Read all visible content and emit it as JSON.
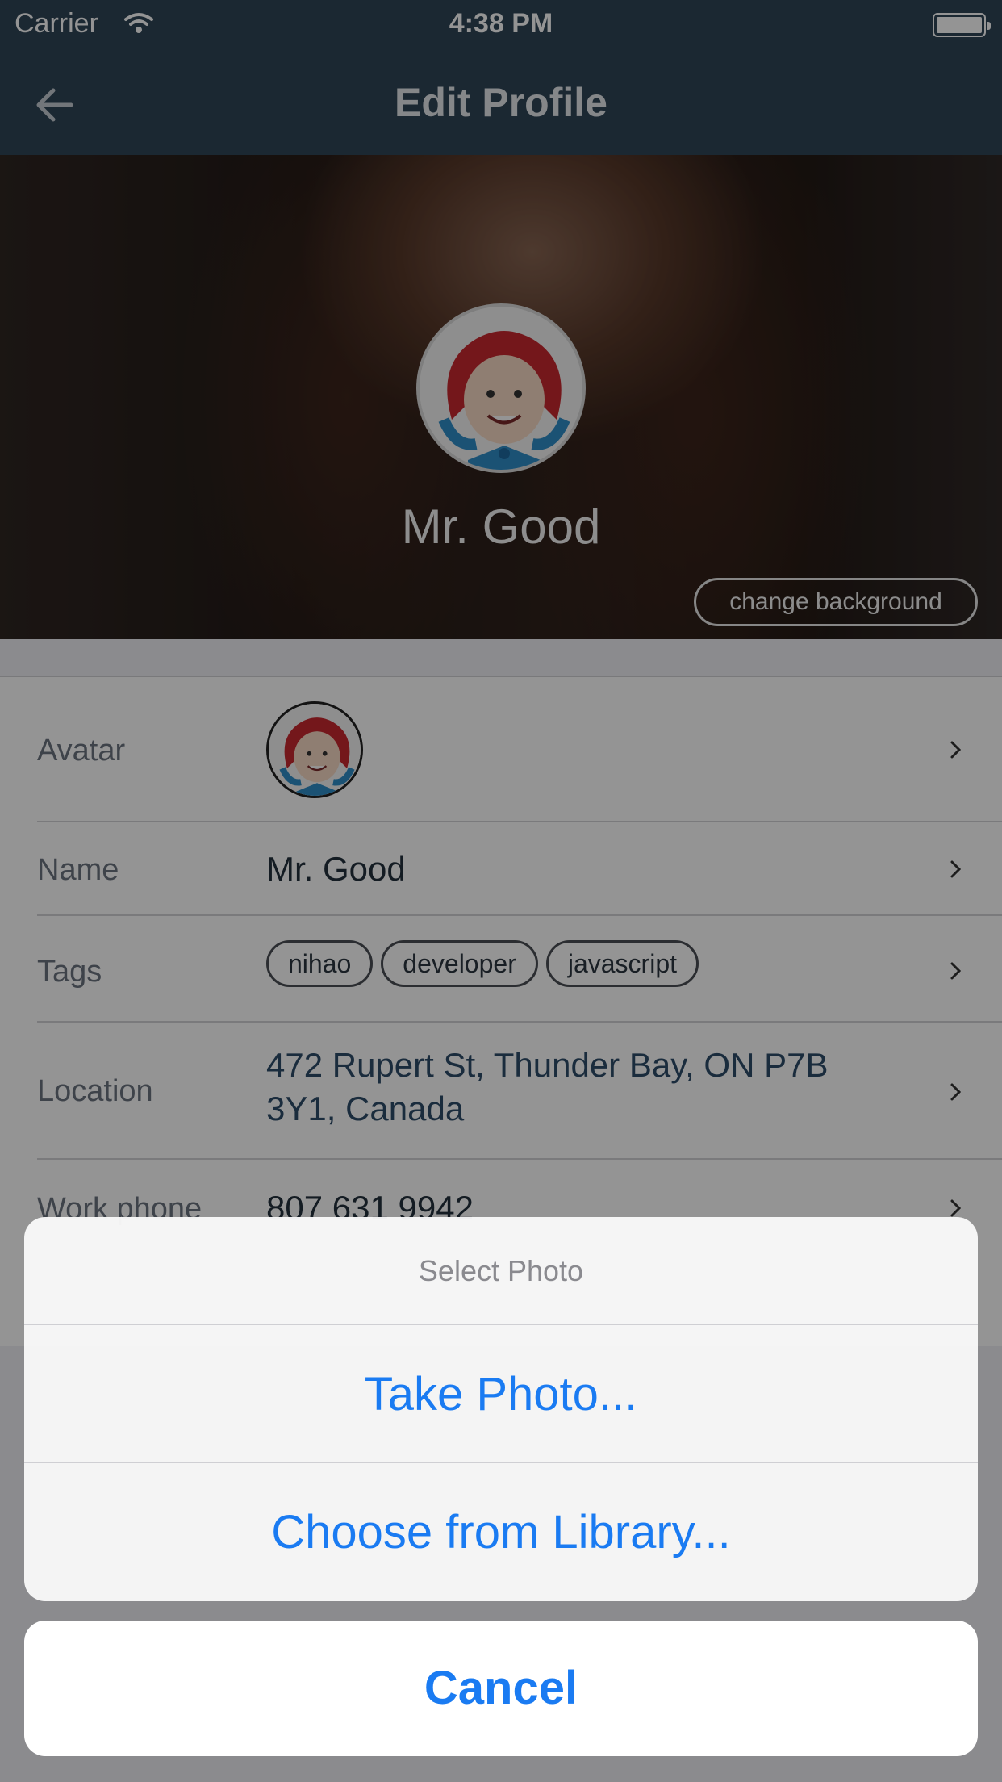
{
  "status_bar": {
    "carrier": "Carrier",
    "time": "4:38 PM"
  },
  "nav": {
    "title": "Edit Profile"
  },
  "hero": {
    "name": "Mr. Good",
    "change_background_label": "change background"
  },
  "profile": {
    "avatar_label": "Avatar",
    "name_label": "Name",
    "name_value": "Mr. Good",
    "tags_label": "Tags",
    "tags": [
      "nihao",
      "developer",
      "javascript"
    ],
    "location_label": "Location",
    "location_value": "472 Rupert St, Thunder Bay, ON P7B 3Y1, Canada",
    "work_phone_label": "Work phone",
    "work_phone_value": "807 631 9942"
  },
  "action_sheet": {
    "title": "Select Photo",
    "actions": [
      "Take Photo...",
      "Choose from Library..."
    ],
    "cancel_label": "Cancel"
  },
  "colors": {
    "nav": "#2f4557",
    "action_blue": "#1a7bf2"
  }
}
